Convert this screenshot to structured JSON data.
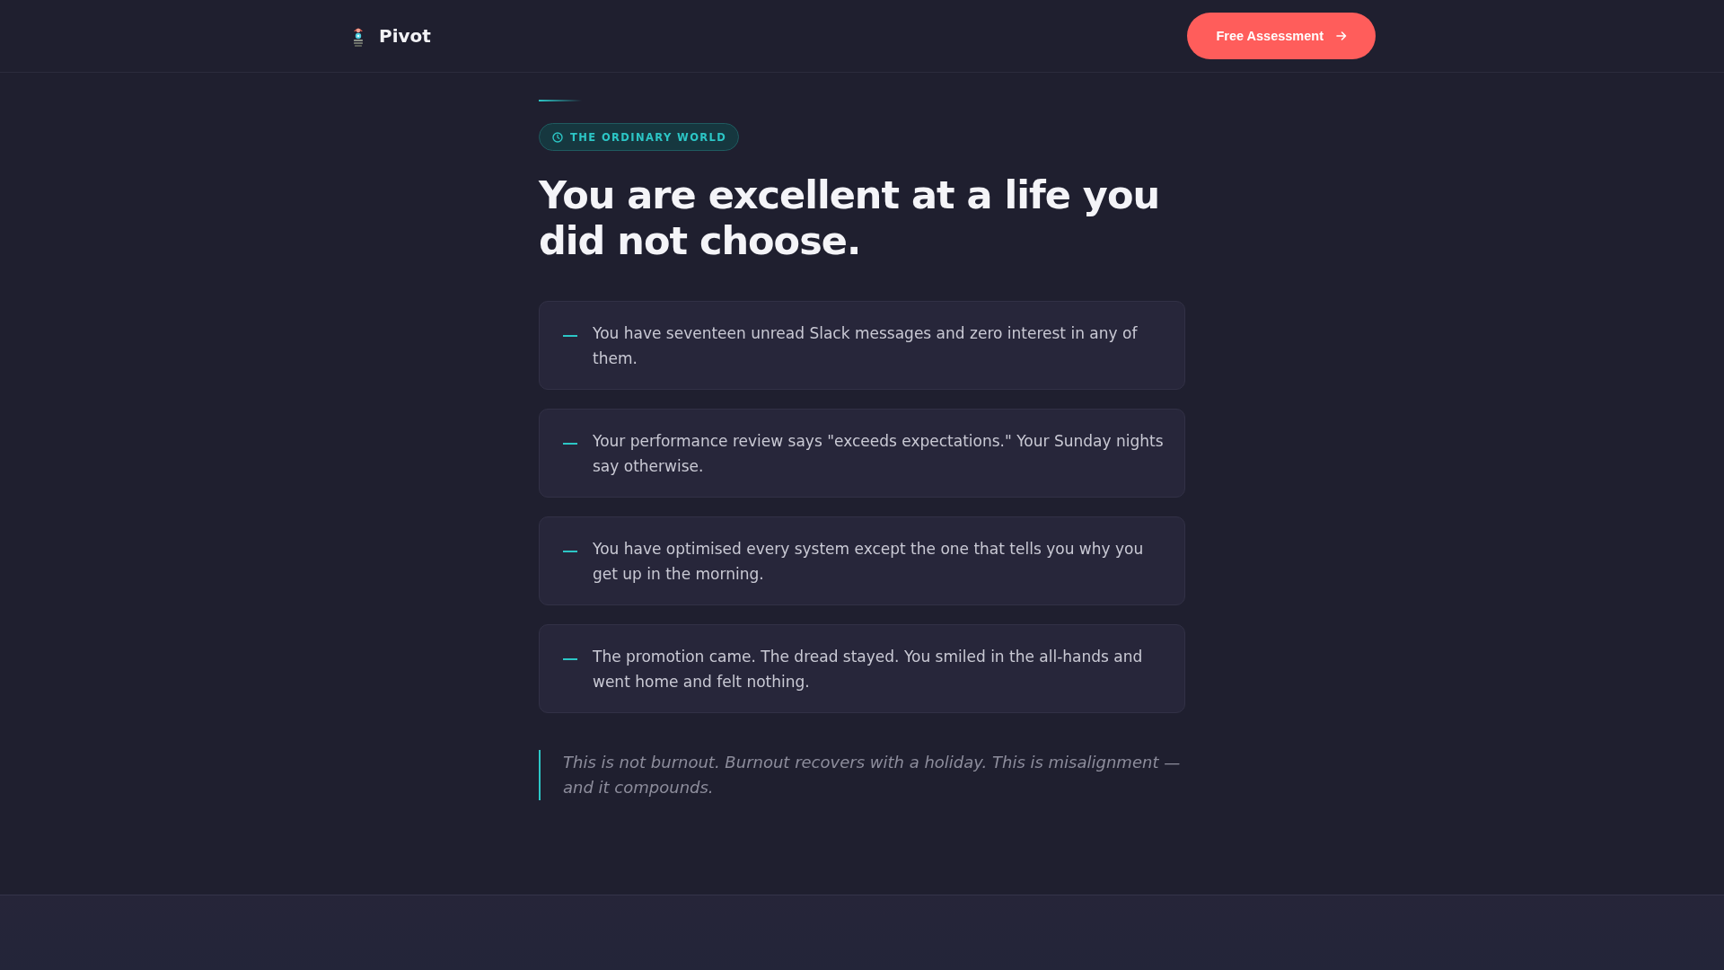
{
  "header": {
    "brand": "Pivot",
    "cta": {
      "label": "Free Assessment"
    }
  },
  "section": {
    "badge": "THE ORDINARY WORLD",
    "heading": "You are excellent at a life you did not choose.",
    "items": [
      "You have seventeen unread Slack messages and zero interest in any of them.",
      "Your performance review says \"exceeds expectations.\" Your Sunday nights say otherwise.",
      "You have optimised every system except the one that tells you why you get up in the morning.",
      "The promotion came. The dread stayed. You smiled in the all-hands and went home and felt nothing."
    ],
    "quote": "This is not burnout. Burnout recovers with a holiday. This is misalignment — and it compounds."
  }
}
